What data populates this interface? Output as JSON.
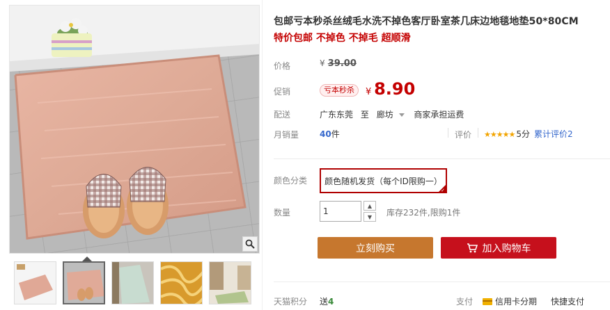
{
  "product": {
    "title": "包邮亏本秒杀丝绒毛水洗不掉色客厅卧室茶几床边地毯地垫50*80CM",
    "subtitle": "特价包邮 不掉色 不掉毛 超顺滑"
  },
  "price": {
    "label": "价格",
    "currency": "¥",
    "original": "39.00"
  },
  "promotion": {
    "label": "促销",
    "tag": "亏本秒杀",
    "currency": "¥",
    "price": "8.90"
  },
  "shipping": {
    "label": "配送",
    "from": "广东东莞",
    "to_word": "至",
    "destination": "廊坊",
    "fee_note": "商家承担运费"
  },
  "sales": {
    "label": "月销量",
    "count": "40",
    "unit": "件",
    "rating_label": "评价",
    "stars": "★★★★★",
    "score": "5分",
    "reviews": "累计评价2"
  },
  "options": {
    "color_label": "颜色分类",
    "color_value": "颜色随机发货（每个ID限购一）",
    "qty_label": "数量",
    "qty_value": "1",
    "stock_text": "库存232件,限购1件"
  },
  "actions": {
    "buy_now": "立刻购买",
    "add_to_cart": "加入购物车"
  },
  "footer": {
    "points_label": "天猫积分",
    "points_prefix": "送",
    "points_value": "4",
    "pay_label": "支付",
    "credit_card": "信用卡分期",
    "express_pay": "快捷支付"
  },
  "colors": {
    "accent_red": "#c40000",
    "buy_orange": "#c6772e",
    "cart_red": "#c6101c",
    "link_blue": "#3366cc"
  }
}
